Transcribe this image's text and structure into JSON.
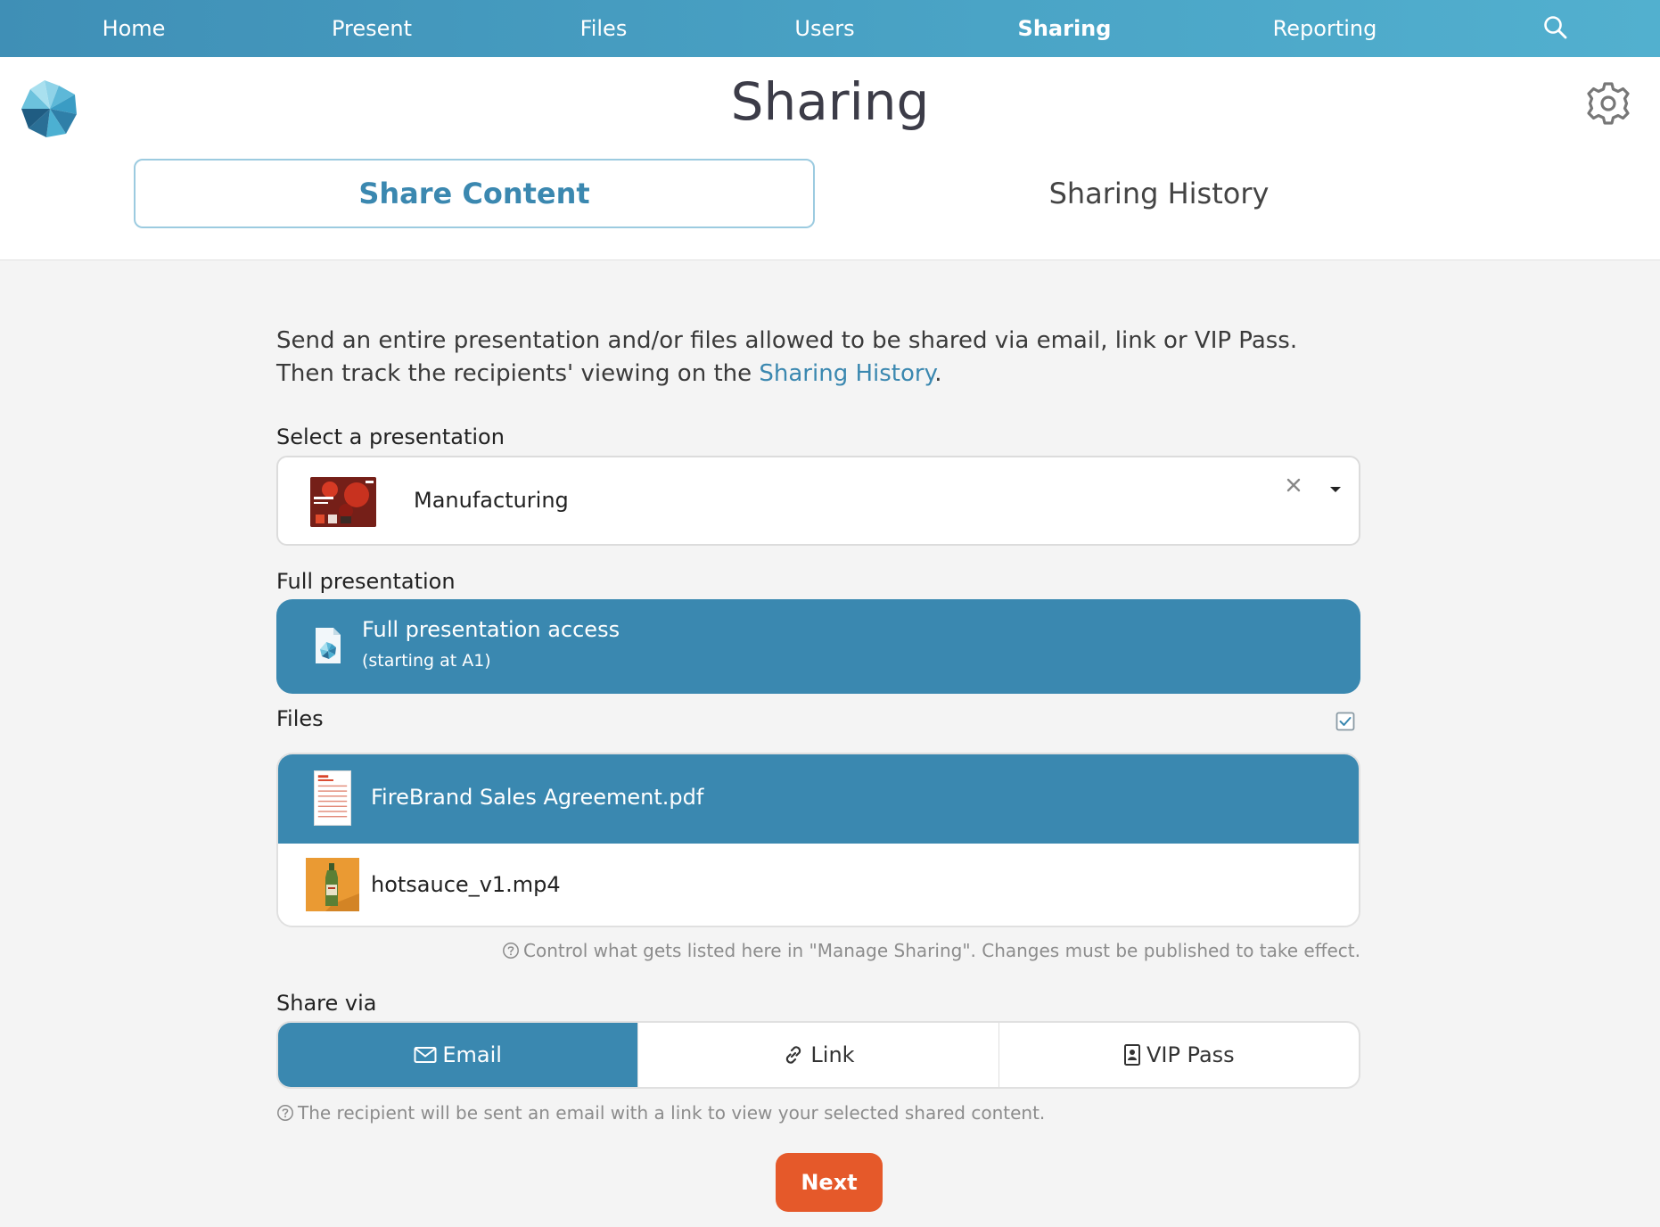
{
  "nav": {
    "items": [
      {
        "label": "Home"
      },
      {
        "label": "Present"
      },
      {
        "label": "Files"
      },
      {
        "label": "Users"
      },
      {
        "label": "Sharing",
        "active": true
      },
      {
        "label": "Reporting"
      }
    ],
    "search_icon": "search-icon"
  },
  "header": {
    "title": "Sharing",
    "settings_icon": "gear-icon",
    "tabs": [
      {
        "label": "Share Content",
        "active": true
      },
      {
        "label": "Sharing History",
        "active": false
      }
    ]
  },
  "main": {
    "intro_text": "Send an entire presentation and/or files allowed to be shared via email, link or VIP Pass. Then track the recipients' viewing on the ",
    "intro_link": "Sharing History",
    "intro_end": ".",
    "select_label": "Select a presentation",
    "selected_presentation": "Manufacturing",
    "full_presentation_label": "Full presentation",
    "full_presentation": {
      "title": "Full presentation access",
      "subtitle": "(starting at A1)",
      "selected": true
    },
    "files_label": "Files",
    "files_select_all_checked": true,
    "files": [
      {
        "name": "FireBrand Sales Agreement.pdf",
        "selected": true,
        "icon": "pdf-thumbnail"
      },
      {
        "name": "hotsauce_v1.mp4",
        "selected": false,
        "icon": "video-thumbnail"
      }
    ],
    "files_hint": "Control what gets listed here in \"Manage Sharing\". Changes must be published to take effect.",
    "share_via_label": "Share via",
    "share_options": [
      {
        "label": "Email",
        "icon": "envelope-icon",
        "active": true
      },
      {
        "label": "Link",
        "icon": "link-icon",
        "active": false
      },
      {
        "label": "VIP Pass",
        "icon": "badge-icon",
        "active": false
      }
    ],
    "share_hint": "The recipient will be sent an email with a link to view your selected shared content.",
    "next_label": "Next"
  },
  "colors": {
    "nav_gradient_start": "#3f8fb6",
    "accent": "#3a88b0",
    "next_button": "#e5592a",
    "background": "#f4f4f4"
  }
}
